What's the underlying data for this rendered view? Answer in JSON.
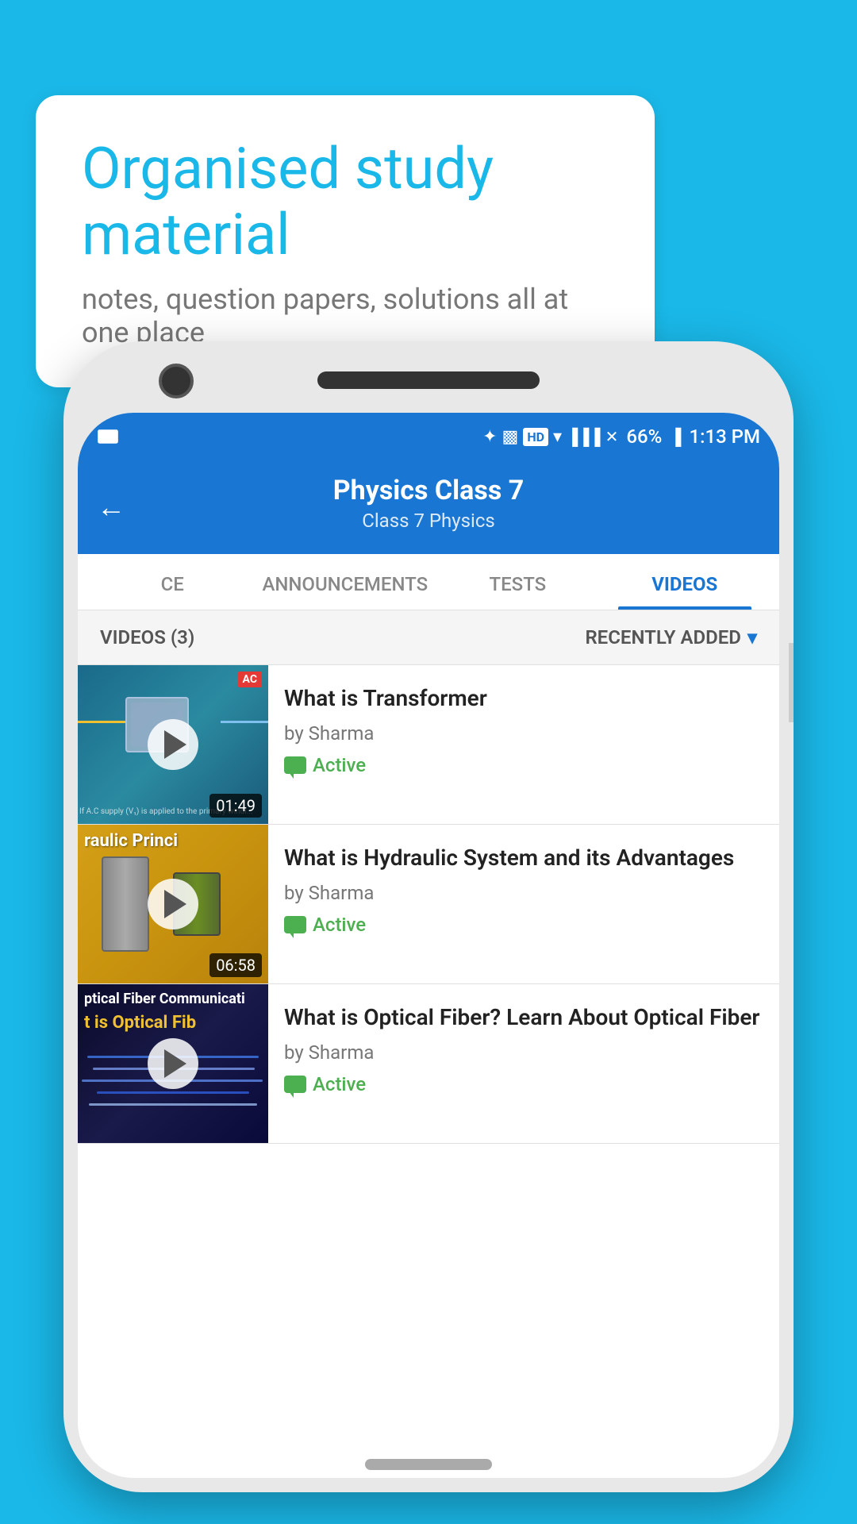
{
  "background_color": "#1ab8e8",
  "speech_bubble": {
    "title": "Organised study material",
    "subtitle": "notes, question papers, solutions all at one place"
  },
  "status_bar": {
    "time": "1:13 PM",
    "battery": "66%",
    "hd_badge": "HD"
  },
  "header": {
    "title": "Physics Class 7",
    "breadcrumb": "Class 7   Physics",
    "back_label": "←"
  },
  "tabs": [
    {
      "id": "ce",
      "label": "CE",
      "active": false
    },
    {
      "id": "announcements",
      "label": "ANNOUNCEMENTS",
      "active": false
    },
    {
      "id": "tests",
      "label": "TESTS",
      "active": false
    },
    {
      "id": "videos",
      "label": "VIDEOS",
      "active": true
    }
  ],
  "filter_bar": {
    "count_label": "VIDEOS (3)",
    "sort_label": "RECENTLY ADDED",
    "sort_icon": "▾"
  },
  "videos": [
    {
      "id": "video-1",
      "title": "What is  Transformer",
      "author": "by Sharma",
      "status": "Active",
      "duration": "01:49",
      "thumbnail_type": "transformer"
    },
    {
      "id": "video-2",
      "title": "What is Hydraulic System and its Advantages",
      "author": "by Sharma",
      "status": "Active",
      "duration": "06:58",
      "thumbnail_type": "hydraulic",
      "thumbnail_text": "raulic Princi"
    },
    {
      "id": "video-3",
      "title": "What is Optical Fiber? Learn About Optical Fiber",
      "author": "by Sharma",
      "status": "Active",
      "duration": "",
      "thumbnail_type": "optical",
      "thumbnail_text1": "ptical Fiber Communicati",
      "thumbnail_text2": "t is Optical Fib"
    }
  ]
}
